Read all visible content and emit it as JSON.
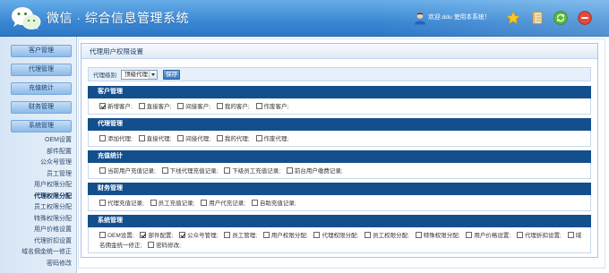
{
  "header": {
    "title": "微信 · 综合信息管理系统",
    "welcome": "欢迎:ddu 使用本系统！",
    "icons": {
      "logo": "wechat-logo-icon",
      "avatar": "user-avatar-icon",
      "favorite": "star-icon",
      "notes": "notebook-icon",
      "refresh": "refresh-icon",
      "exit": "stop-icon"
    }
  },
  "sidebar": {
    "menus": [
      {
        "label": "客户管理"
      },
      {
        "label": "代理管理"
      },
      {
        "label": "充值统计"
      },
      {
        "label": "财务管理"
      },
      {
        "label": "系统管理"
      }
    ],
    "sub_items": [
      {
        "label": "OEM设置"
      },
      {
        "label": "部件配置"
      },
      {
        "label": "公众号管理"
      },
      {
        "label": "员工管理"
      },
      {
        "label": "用户权限分配"
      },
      {
        "label": "代理权限分配",
        "active": true
      },
      {
        "label": "员工权限分配"
      },
      {
        "label": "特殊权限分配"
      },
      {
        "label": "用户价格设置"
      },
      {
        "label": "代理折扣设置"
      },
      {
        "label": "域名佣金统一修正"
      },
      {
        "label": "密码修改"
      }
    ]
  },
  "panel": {
    "title": "代理用户权限设置",
    "level_label": "代理级别",
    "level_selected": "顶级代理",
    "save_label": "保存",
    "sections": [
      {
        "title": "客户管理",
        "items": [
          {
            "label": "新增客户;",
            "checked": true
          },
          {
            "label": "直接客户;",
            "checked": false
          },
          {
            "label": "间接客户;",
            "checked": false
          },
          {
            "label": "我的客户;",
            "checked": false
          },
          {
            "label": "作废客户;",
            "checked": false
          }
        ]
      },
      {
        "title": "代理管理",
        "items": [
          {
            "label": "添加代理;",
            "checked": false
          },
          {
            "label": "直接代理;",
            "checked": false
          },
          {
            "label": "间接代理;",
            "checked": false
          },
          {
            "label": "我的代理;",
            "checked": false
          },
          {
            "label": "作废代理;",
            "checked": false
          }
        ]
      },
      {
        "title": "充值统计",
        "items": [
          {
            "label": "当前用户充值记录;",
            "checked": false
          },
          {
            "label": "下线代理充值记录;",
            "checked": false
          },
          {
            "label": "下级员工充值记录;",
            "checked": false
          },
          {
            "label": "前台用户缴费记录;",
            "checked": false
          }
        ]
      },
      {
        "title": "财务管理",
        "items": [
          {
            "label": "代理充值记录;",
            "checked": false
          },
          {
            "label": "员工充值记录;",
            "checked": false
          },
          {
            "label": "用户代充记录;",
            "checked": false
          },
          {
            "label": "自助充值记录;",
            "checked": false
          }
        ]
      },
      {
        "title": "系统管理",
        "items": [
          {
            "label": "OEM设置;",
            "checked": false
          },
          {
            "label": "部件配置;",
            "checked": true
          },
          {
            "label": "公众号管理;",
            "checked": true
          },
          {
            "label": "员工管理;",
            "checked": false
          },
          {
            "label": "用户权限分配;",
            "checked": false
          },
          {
            "label": "代理权限分配;",
            "checked": false
          },
          {
            "label": "员工权限分配;",
            "checked": false
          },
          {
            "label": "特殊权限分配;",
            "checked": false
          },
          {
            "label": "用户价格设置;",
            "checked": false
          },
          {
            "label": "代理折扣设置;",
            "checked": false
          },
          {
            "label": "域名佣金统一修正;",
            "checked": false
          },
          {
            "label": "密码修改;",
            "checked": false
          }
        ]
      }
    ]
  },
  "colors": {
    "header": "#3a86d2",
    "section_header": "#144f8d",
    "menu_button": "#8dbbe8",
    "save_button": "#3a78bd"
  }
}
